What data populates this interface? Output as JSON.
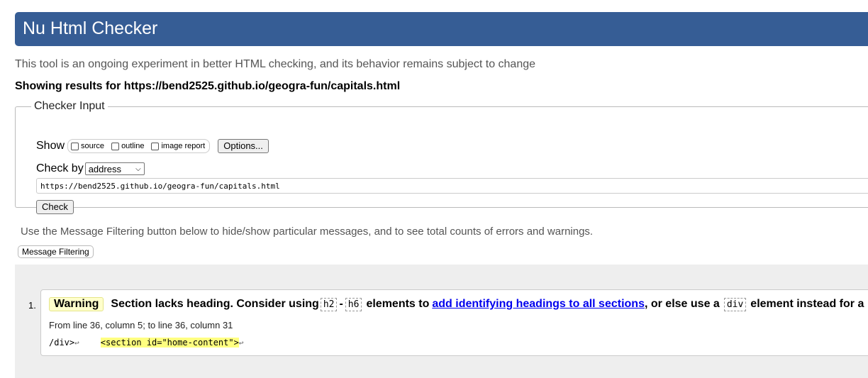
{
  "header": {
    "title": "Nu Html Checker"
  },
  "subtitle": "This tool is an ongoing experiment in better HTML checking, and its behavior remains subject to change",
  "results_for": "Showing results for https://bend2525.github.io/geogra-fun/capitals.html",
  "checker_input": {
    "legend": "Checker Input",
    "show_label": "Show",
    "show_options": [
      {
        "label": "source",
        "checked": false
      },
      {
        "label": "outline",
        "checked": false
      },
      {
        "label": "image report",
        "checked": false
      }
    ],
    "options_button": "Options...",
    "check_by_label": "Check by",
    "check_by_value": "address",
    "url_value": "https://bend2525.github.io/geogra-fun/capitals.html",
    "check_button": "Check"
  },
  "filter": {
    "note": "Use the Message Filtering button below to hide/show particular messages, and to see total counts of errors and warnings.",
    "button": "Message Filtering"
  },
  "messages": [
    {
      "number": "1.",
      "type": "Warning",
      "text_before": "Section lacks heading. Consider using",
      "code_a": "h2",
      "dash": "-",
      "code_b": "h6",
      "text_mid": "elements to",
      "link": "add identifying headings to all sections",
      "text_after": ", or else use a",
      "code_c": "div",
      "text_end": "element instead for a",
      "location": "From line 36, column 5; to line 36, column 31",
      "extract_before": "/div>",
      "lf": "↩",
      "extract_highlight": "<section id=\"home-content\">"
    }
  ],
  "colors": {
    "header_bg": "#365d95",
    "warning_badge_bg": "#ffffcc",
    "highlight": "#ffff80",
    "link": "#0000ee"
  }
}
